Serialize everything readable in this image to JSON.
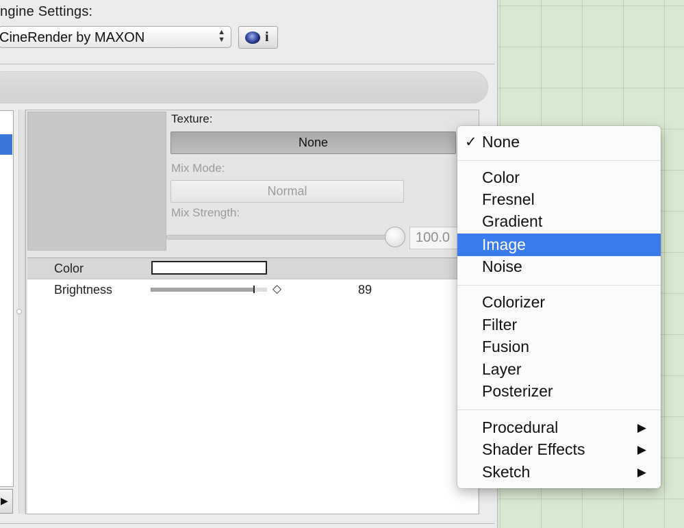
{
  "engine": {
    "title": "ngine Settings:",
    "selected": "CineRender by MAXON",
    "info_label": "i"
  },
  "texture": {
    "label": "Texture:",
    "value": "None",
    "mix_mode_label": "Mix Mode:",
    "mix_mode_value": "Normal",
    "mix_strength_label": "Mix Strength:",
    "mix_strength_value": "100.0",
    "mix_strength_fraction": 1.0
  },
  "properties": {
    "color_label": "Color",
    "brightness_label": "Brightness",
    "brightness_value": "89",
    "brightness_fraction": 0.89
  },
  "menu": {
    "items": [
      {
        "label": "None",
        "checked": true
      },
      {
        "label": "Color"
      },
      {
        "label": "Fresnel"
      },
      {
        "label": "Gradient"
      },
      {
        "label": "Image",
        "highlighted": true
      },
      {
        "label": "Noise"
      },
      {
        "label": "Colorizer"
      },
      {
        "label": "Filter"
      },
      {
        "label": "Fusion"
      },
      {
        "label": "Layer"
      },
      {
        "label": "Posterizer"
      },
      {
        "label": "Procedural",
        "submenu": true
      },
      {
        "label": "Shader Effects",
        "submenu": true
      },
      {
        "label": "Sketch",
        "submenu": true
      }
    ],
    "check_glyph": "✓",
    "submenu_glyph": "▶"
  },
  "colors": {
    "highlight": "#3a7cf0",
    "selection": "#3b77d8",
    "canvas_grid": "#d9e8d2"
  }
}
